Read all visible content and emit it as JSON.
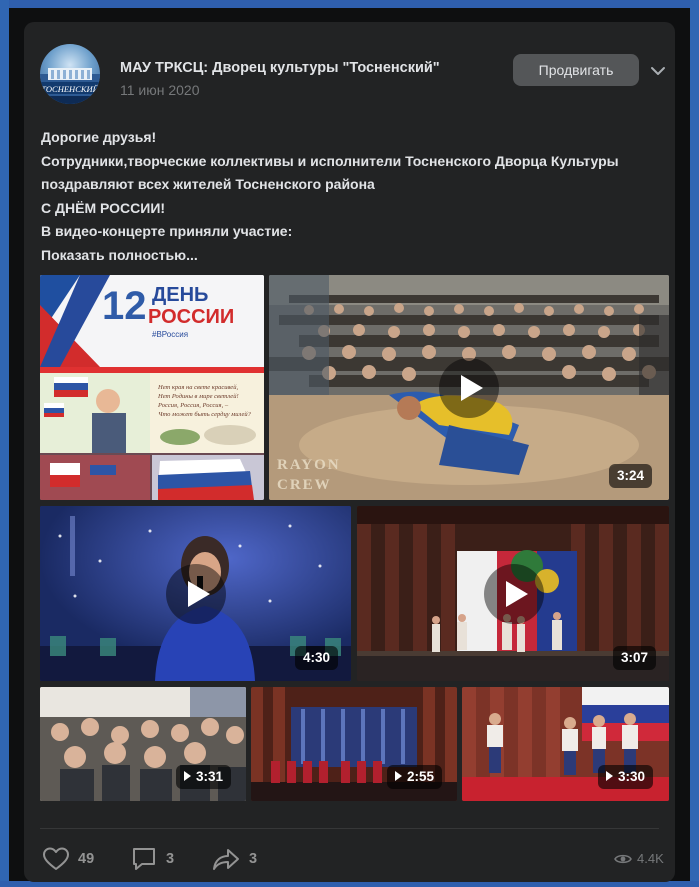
{
  "post": {
    "group_name": "МАУ ТРКСЦ: Дворец культуры \"Тосненский\"",
    "date": "11 июн 2020",
    "promote_label": "Продвигать",
    "avatar_text": "ТОСНЕНСКИЙ",
    "text_lines": [
      "Дорогие друзья!",
      "Сотрудники,творческие коллективы и исполнители Тосненского Дворца Культуры",
      "поздравляют всех жителей Тосненского района",
      "С ДНЁМ РОССИИ!",
      "В видео-концерте приняли участие:"
    ],
    "show_more": "Показать полностью..."
  },
  "media": {
    "poster": {
      "number": "12",
      "day_word": "ДЕНЬ",
      "russia_word": "РОССИИ",
      "hashtag": "#ВРоссия",
      "poem_lines": [
        "Нет края на свете красивей,",
        "Нет Родины в мире светлей!",
        "Россия, Россия, Россия, –",
        "Что может быть сердцу милей?"
      ]
    },
    "videos": [
      {
        "duration": "3:24",
        "watermark": "RAYON CREW"
      },
      {
        "duration": "4:30"
      },
      {
        "duration": "3:07"
      },
      {
        "duration": "3:31"
      },
      {
        "duration": "2:55"
      },
      {
        "duration": "3:30"
      }
    ]
  },
  "actions": {
    "likes": "49",
    "comments": "3",
    "shares": "3",
    "views": "4.4K"
  },
  "colors": {
    "page_frame": "#2a5aa7",
    "card_bg": "#222324",
    "text_primary": "#e1e3e6",
    "text_secondary": "#76787a",
    "button_bg": "#545658"
  }
}
